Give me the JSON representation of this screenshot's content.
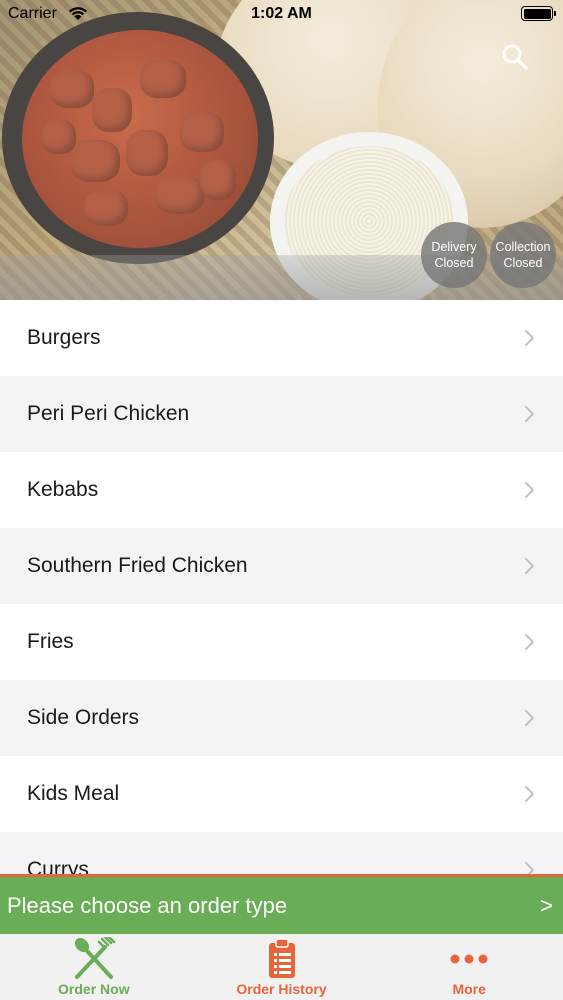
{
  "status_bar": {
    "carrier": "Carrier",
    "time": "1:02 AM"
  },
  "hero": {
    "image": "curry-rice-naan-photo",
    "search_icon": "search-icon",
    "delivery": {
      "line1": "Delivery",
      "line2": "Closed"
    },
    "collection": {
      "line1": "Collection",
      "line2": "Closed"
    }
  },
  "menu": {
    "items": [
      {
        "label": "Burgers"
      },
      {
        "label": "Peri Peri Chicken"
      },
      {
        "label": "Kebabs"
      },
      {
        "label": "Southern Fried Chicken"
      },
      {
        "label": "Fries"
      },
      {
        "label": "Side Orders"
      },
      {
        "label": "Kids Meal"
      },
      {
        "label": "Currys"
      }
    ]
  },
  "order_bar": {
    "label": "Please choose an order type",
    "arrow": ">"
  },
  "tabs": [
    {
      "label": "Order Now",
      "icon": "fork-knife-icon",
      "color": "#6aad57"
    },
    {
      "label": "Order History",
      "icon": "clipboard-icon",
      "color": "#e8643b"
    },
    {
      "label": "More",
      "icon": "more-dots-icon",
      "color": "#e8643b"
    }
  ],
  "colors": {
    "accent_green": "#6aad57",
    "accent_orange": "#e8643b"
  }
}
